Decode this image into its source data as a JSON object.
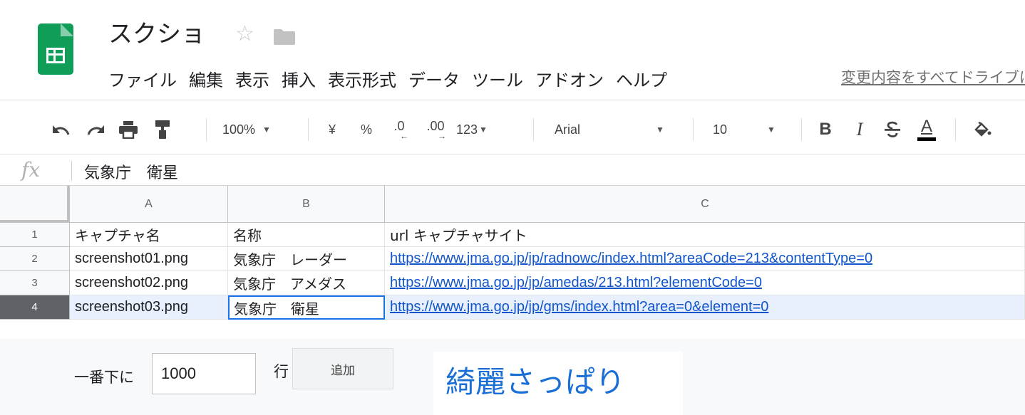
{
  "header": {
    "title": "スクショ",
    "last_edit": "変更内容をすべてドライブに保存しました"
  },
  "menu": [
    "ファイル",
    "編集",
    "表示",
    "挿入",
    "表示形式",
    "データ",
    "ツール",
    "アドオン",
    "ヘルプ"
  ],
  "toolbar": {
    "zoom": "100%",
    "currency": "¥",
    "percent": "%",
    "decrease_decimal": ".0",
    "increase_decimal": ".00",
    "more_formats": "123",
    "font": "Arial",
    "font_size": "10",
    "bold": "B",
    "italic": "I",
    "text_color": "A"
  },
  "formula": {
    "fx": "fx",
    "value": "気象庁　衛星"
  },
  "grid": {
    "columns": [
      "A",
      "B",
      "C"
    ],
    "rows": [
      {
        "num": "1",
        "a": "キャプチャ名",
        "b": "名称",
        "c": "url キャプチャサイト"
      },
      {
        "num": "2",
        "a": "screenshot01.png",
        "b": "気象庁　レーダー",
        "c": "https://www.jma.go.jp/jp/radnowc/index.html?areaCode=213&contentType=0"
      },
      {
        "num": "3",
        "a": "screenshot02.png",
        "b": "気象庁　アメダス",
        "c": "https://www.jma.go.jp/jp/amedas/213.html?elementCode=0"
      },
      {
        "num": "4",
        "a": "screenshot03.png",
        "b": "気象庁　衛星",
        "c": "https://www.jma.go.jp/jp/gms/index.html?area=0&element=0"
      }
    ]
  },
  "add_rows": {
    "label": "一番下に",
    "count": "1000",
    "unit": "行",
    "button": "追加"
  },
  "caption": "綺麗さっぱり",
  "colors": {
    "sheets_green": "#0f9d58",
    "link": "#1155cc",
    "selection": "#1a73e8",
    "caption": "#1a6fd6"
  }
}
